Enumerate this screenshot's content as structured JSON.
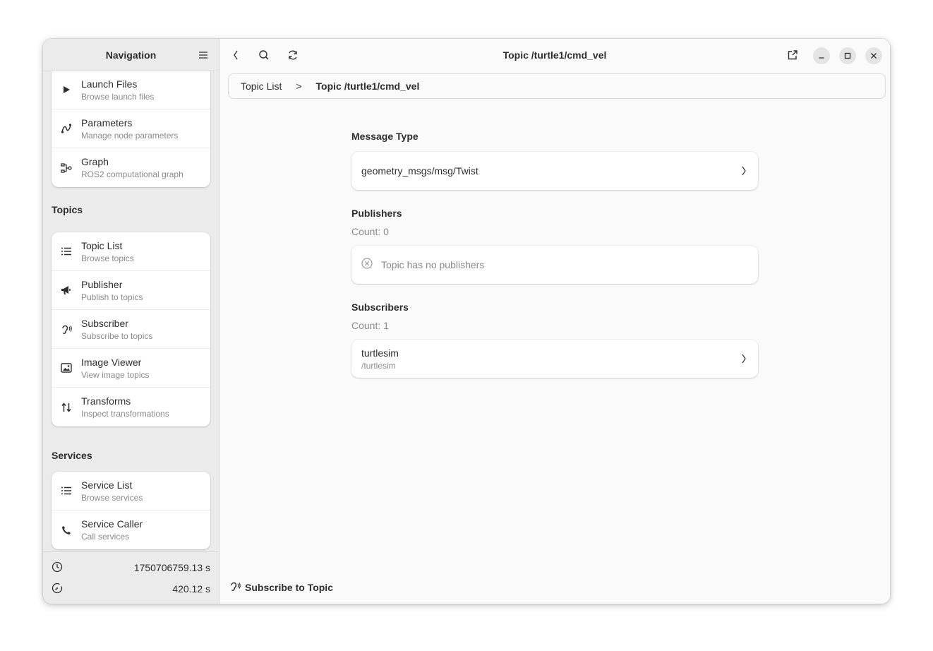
{
  "sidebar": {
    "title": "Navigation",
    "menu_icon": "hamburger-menu-icon",
    "top_items": [
      {
        "label": "Launch Files",
        "sub": "Browse launch files",
        "icon": "play-icon"
      },
      {
        "label": "Parameters",
        "sub": "Manage node parameters",
        "icon": "parameters-curve-icon"
      },
      {
        "label": "Graph",
        "sub": "ROS2 computational graph",
        "icon": "graph-icon"
      }
    ],
    "topics_title": "Topics",
    "topics_items": [
      {
        "label": "Topic List",
        "sub": "Browse topics",
        "icon": "list-icon"
      },
      {
        "label": "Publisher",
        "sub": "Publish to topics",
        "icon": "megaphone-icon"
      },
      {
        "label": "Subscriber",
        "sub": "Subscribe to topics",
        "icon": "ear-icon"
      },
      {
        "label": "Image Viewer",
        "sub": "View image topics",
        "icon": "image-icon"
      },
      {
        "label": "Transforms",
        "sub": "Inspect transformations",
        "icon": "transform-arrows-icon"
      }
    ],
    "services_title": "Services",
    "services_items": [
      {
        "label": "Service List",
        "sub": "Browse services",
        "icon": "list-icon"
      },
      {
        "label": "Service Caller",
        "sub": "Call services",
        "icon": "phone-icon"
      }
    ],
    "footer": {
      "clock_value": "1750706759.13 s",
      "uptime_value": "420.12 s"
    }
  },
  "header": {
    "title": "Topic /turtle1/cmd_vel"
  },
  "breadcrumb": {
    "link": "Topic List",
    "separator": ">",
    "current": "Topic /turtle1/cmd_vel"
  },
  "content": {
    "message_type_heading": "Message Type",
    "message_type_value": "geometry_msgs/msg/Twist",
    "publishers_heading": "Publishers",
    "publishers_count": "Count: 0",
    "publishers_empty": "Topic has no publishers",
    "subscribers_heading": "Subscribers",
    "subscribers_count": "Count: 1",
    "subscribers": [
      {
        "name": "turtlesim",
        "path": "/turtlesim"
      }
    ]
  },
  "bottom_action": {
    "label": "Subscribe to Topic"
  }
}
